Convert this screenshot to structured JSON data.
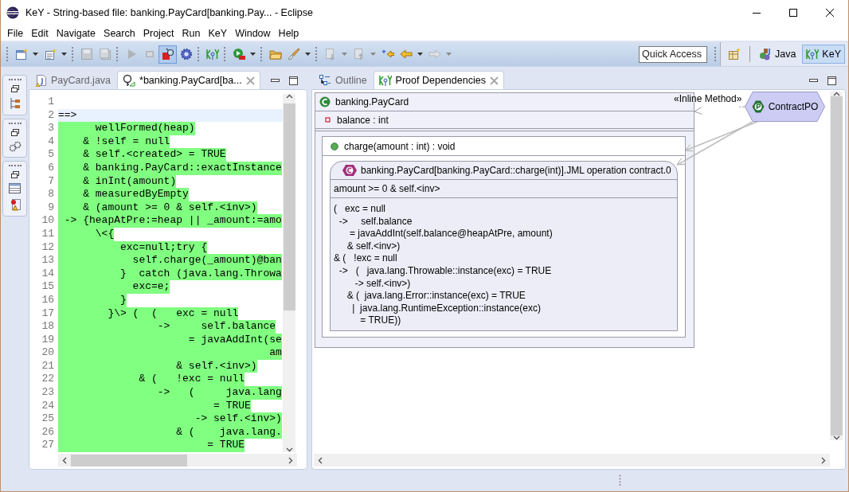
{
  "window": {
    "title": "KeY - String-based file: banking.PayCard[banking.Pay... - Eclipse"
  },
  "menu": [
    {
      "label": "File"
    },
    {
      "label": "Edit"
    },
    {
      "label": "Navigate"
    },
    {
      "label": "Search"
    },
    {
      "label": "Project"
    },
    {
      "label": "Run"
    },
    {
      "label": "KeY"
    },
    {
      "label": "Window"
    },
    {
      "label": "Help"
    }
  ],
  "toolbar": [
    {
      "kind": "new-wizard",
      "dropdown": true,
      "disabled": false,
      "pressed": false
    },
    {
      "kind": "new-item",
      "dropdown": true,
      "disabled": false,
      "pressed": false
    },
    {
      "kind": "separator"
    },
    {
      "kind": "save",
      "dropdown": false,
      "disabled": true,
      "pressed": false
    },
    {
      "kind": "save-all",
      "dropdown": false,
      "disabled": true,
      "pressed": false
    },
    {
      "kind": "separator"
    },
    {
      "kind": "play",
      "dropdown": false,
      "disabled": true,
      "pressed": false
    },
    {
      "kind": "stop",
      "dropdown": false,
      "disabled": true,
      "pressed": false
    },
    {
      "kind": "square-lens",
      "dropdown": false,
      "disabled": false,
      "pressed": true
    },
    {
      "kind": "gear",
      "dropdown": false,
      "disabled": false,
      "pressed": false
    },
    {
      "kind": "separator"
    },
    {
      "kind": "key-logo",
      "dropdown": false,
      "disabled": false,
      "pressed": false
    },
    {
      "kind": "separator"
    },
    {
      "kind": "run",
      "dropdown": true,
      "disabled": false,
      "pressed": false
    },
    {
      "kind": "separator"
    },
    {
      "kind": "folder",
      "dropdown": false,
      "disabled": false,
      "pressed": false
    },
    {
      "kind": "brush",
      "dropdown": true,
      "disabled": false,
      "pressed": false
    },
    {
      "kind": "separator"
    },
    {
      "kind": "doc-down",
      "dropdown": true,
      "disabled": true,
      "pressed": false
    },
    {
      "kind": "doc-up",
      "dropdown": true,
      "disabled": true,
      "pressed": false
    },
    {
      "kind": "star-back",
      "dropdown": false,
      "disabled": false,
      "pressed": false
    },
    {
      "kind": "back",
      "dropdown": true,
      "disabled": false,
      "pressed": false
    },
    {
      "kind": "forward",
      "dropdown": true,
      "disabled": true,
      "pressed": false
    }
  ],
  "quick_access": {
    "placeholder": "Quick Access"
  },
  "perspectives": [
    {
      "label": "Java",
      "selected": false
    },
    {
      "label": "KeY",
      "selected": true
    }
  ],
  "editor": {
    "tabs": [
      {
        "label": "PayCard.java",
        "selected": false
      },
      {
        "label": "*banking.PayCard[ba...",
        "selected": true
      }
    ],
    "lines": [
      {
        "number": "1"
      },
      {
        "number": "2",
        "text": "==>",
        "highlighted": false,
        "current": true
      },
      {
        "number": "3",
        "text": "      wellFormed(heap)",
        "highlighted": true,
        "current": false
      },
      {
        "number": "4",
        "text": "    & !self = null",
        "highlighted": true,
        "current": false
      },
      {
        "number": "5",
        "text": "    & self.<created> = TRUE",
        "highlighted": true,
        "current": false
      },
      {
        "number": "6",
        "text": "    & banking.PayCard::exactInstance",
        "highlighted": true,
        "current": false
      },
      {
        "number": "7",
        "text": "    & inInt(amount)",
        "highlighted": true,
        "current": false
      },
      {
        "number": "8",
        "text": "    & measuredByEmpty",
        "highlighted": true,
        "current": false
      },
      {
        "number": "9",
        "text": "    & (amount >= 0 & self.<inv>)",
        "highlighted": true,
        "current": false
      },
      {
        "number": "10",
        "text": " -> {heapAtPre:=heap || _amount:=amo",
        "highlighted": true,
        "current": false
      },
      {
        "number": "11",
        "text": "      \\<{",
        "highlighted": true,
        "current": false
      },
      {
        "number": "12",
        "text": "          exc=null;try {",
        "highlighted": true,
        "current": false
      },
      {
        "number": "13",
        "text": "            self.charge(_amount)@ban",
        "highlighted": true,
        "current": false
      },
      {
        "number": "14",
        "text": "          }  catch (java.lang.Throwa",
        "highlighted": true,
        "current": false
      },
      {
        "number": "15",
        "text": "            exc=e;",
        "highlighted": true,
        "current": false
      },
      {
        "number": "16",
        "text": "          }",
        "highlighted": true,
        "current": false
      },
      {
        "number": "17",
        "text": "        }\\> (  (   exc = null",
        "highlighted": true,
        "current": false
      },
      {
        "number": "18",
        "text": "                ->     self.balance",
        "highlighted": true,
        "current": false
      },
      {
        "number": "19",
        "text": "                     = javaAddInt(se",
        "highlighted": true,
        "current": false
      },
      {
        "number": "20",
        "text": "                                  am",
        "highlighted": true,
        "current": false
      },
      {
        "number": "21",
        "text": "                   & self.<inv>)",
        "highlighted": true,
        "current": false
      },
      {
        "number": "22",
        "text": "             & (   !exc = null",
        "highlighted": true,
        "current": false
      },
      {
        "number": "23",
        "text": "                ->   (     java.lang",
        "highlighted": true,
        "current": false
      },
      {
        "number": "24",
        "text": "                         = TRUE",
        "highlighted": true,
        "current": false
      },
      {
        "number": "25",
        "text": "                      -> self.<inv>)",
        "highlighted": true,
        "current": false
      },
      {
        "number": "26",
        "text": "                   & (    java.lang.",
        "highlighted": true,
        "current": false
      },
      {
        "number": "27",
        "text": "                        = TRUE",
        "highlighted": true,
        "current": false
      }
    ]
  },
  "views": {
    "tabs": [
      {
        "label": "Outline",
        "selected": false
      },
      {
        "label": "Proof Dependencies",
        "selected": true
      }
    ],
    "class_node": {
      "title": "banking.PayCard",
      "attributes": [
        "balance : int"
      ],
      "methods": [
        {
          "signature": "charge(amount : int) : void",
          "contracts": [
            {
              "title": "banking.PayCard[banking.PayCard::charge(int)].JML operation contract.0",
              "precondition": "amount >= 0 & self.<inv>",
              "postcondition": [
                "(   exc = null",
                "  ->     self.balance",
                "      = javaAddInt(self.balance@heapAtPre, amount)",
                "     & self.<inv>)",
                "& (   !exc = null",
                "  ->   (   java.lang.Throwable::instance(exc) = TRUE",
                "        -> self.<inv>)",
                "     & (  java.lang.Error::instance(exc) = TRUE",
                "       |  java.lang.RuntimeException::instance(exc)",
                "          = TRUE))"
              ]
            }
          ]
        }
      ]
    },
    "proof_node": {
      "label": "ContractPO"
    },
    "edges": [
      {
        "kind": "class-link",
        "label": "«Inline Method»"
      },
      {
        "kind": "method-link"
      },
      {
        "kind": "contract-link"
      }
    ]
  }
}
